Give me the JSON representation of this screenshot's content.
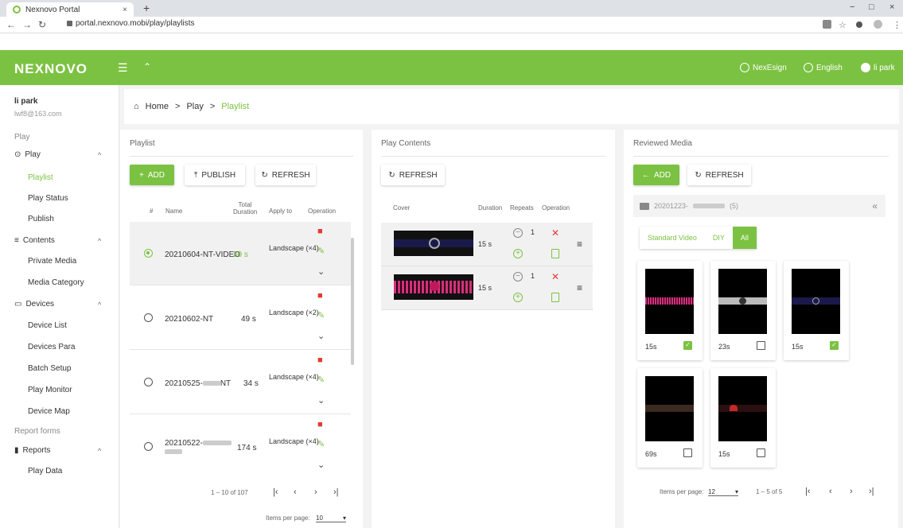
{
  "browser": {
    "tab_title": "Nexnovo Portal",
    "url": "portal.nexnovo.mobi/play/playlists",
    "new_tab": "+",
    "close": "×",
    "win_min": "−",
    "win_max": "□",
    "win_close": "×"
  },
  "header": {
    "logo": "NEXNOVO",
    "nexesign": "NexEsign",
    "language": "English",
    "user": "li park"
  },
  "sidebar": {
    "user_name": "li park",
    "user_email": "lwf8@163.com",
    "section_play": "Play",
    "group_play": "Play",
    "items_play": [
      "Playlist",
      "Play Status",
      "Publish"
    ],
    "group_contents": "Contents",
    "items_contents": [
      "Private Media",
      "Media Category"
    ],
    "group_devices": "Devices",
    "items_devices": [
      "Device List",
      "Devices Para",
      "Batch Setup",
      "Play Monitor",
      "Device Map"
    ],
    "section_report": "Report forms",
    "group_reports": "Reports",
    "items_reports": [
      "Play Data"
    ]
  },
  "breadcrumb": {
    "home": "Home",
    "sep": ">",
    "play": "Play",
    "current": "Playlist"
  },
  "playlist": {
    "title": "Playlist",
    "add": "ADD",
    "publish": "PUBLISH",
    "refresh": "REFRESH",
    "headers": {
      "num": "#",
      "name": "Name",
      "total_duration": "Total Duration",
      "apply_to": "Apply to",
      "operation": "Operation"
    },
    "rows": [
      {
        "name": "20210604-NT-VIDEO",
        "duration": "30 s",
        "apply": "Landscape (×4)",
        "selected": true
      },
      {
        "name": "20210602-NT",
        "duration": "49 s",
        "apply": "Landscape (×2)",
        "selected": false
      },
      {
        "name_a": "20210525-",
        "name_b": "NT",
        "duration": "34 s",
        "apply": "Landscape (×4)",
        "selected": false
      },
      {
        "name_a": "20210522-",
        "duration": "174 s",
        "apply": "Landscape (×4)",
        "selected": false
      }
    ],
    "range": "1 – 10 of 107",
    "items_per_page_label": "Items per page:",
    "items_per_page": "10"
  },
  "play_contents": {
    "title": "Play Contents",
    "refresh": "REFRESH",
    "headers": {
      "cover": "Cover",
      "duration": "Duration",
      "repeats": "Repeats",
      "operation": "Operation"
    },
    "rows": [
      {
        "duration": "15 s",
        "repeats": "1"
      },
      {
        "duration": "15 s",
        "repeats": "1"
      }
    ]
  },
  "reviewed_media": {
    "title": "Reviewed Media",
    "add": "ADD",
    "refresh": "REFRESH",
    "folder_name": "20201223-",
    "folder_count": "(5)",
    "filters": [
      "Standard Video",
      "DIY",
      "All"
    ],
    "active_filter": "All",
    "cards": [
      {
        "duration": "15s",
        "checked": true
      },
      {
        "duration": "23s",
        "checked": false
      },
      {
        "duration": "15s",
        "checked": true
      },
      {
        "duration": "69s",
        "checked": false
      },
      {
        "duration": "15s",
        "checked": false
      }
    ],
    "items_per_page_label": "Items per page:",
    "items_per_page": "12",
    "range": "1 – 5 of 5"
  },
  "colors": {
    "brand": "#7cc242",
    "danger": "#e53935"
  }
}
